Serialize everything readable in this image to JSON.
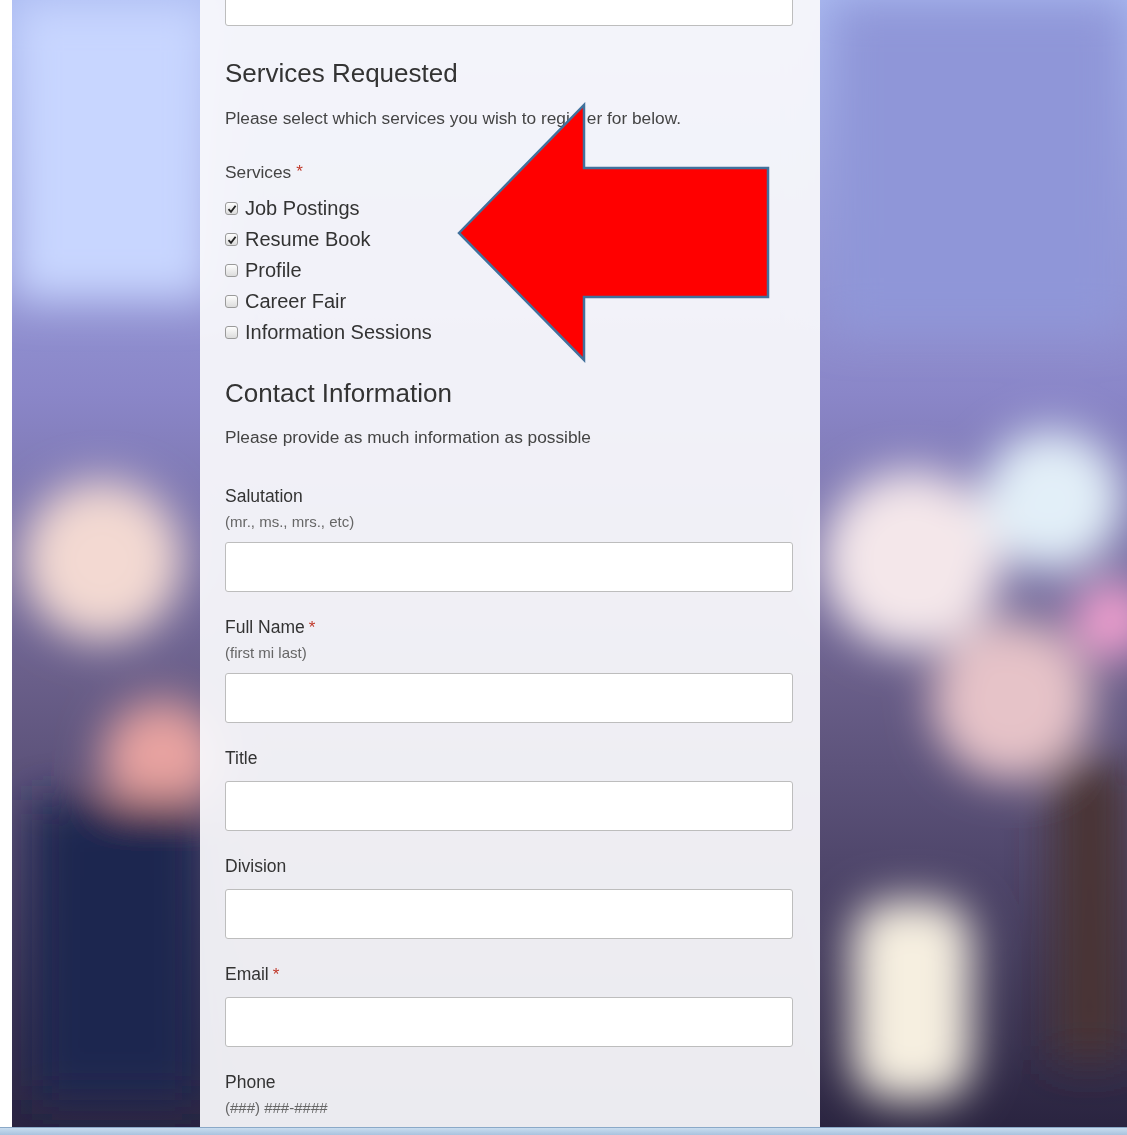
{
  "services": {
    "heading": "Services Requested",
    "description_parts": [
      "Please select which services you wish to regi",
      "er for below."
    ],
    "group_label": "Services",
    "required_mark": "*",
    "options": [
      {
        "label": "Job Postings",
        "checked": true
      },
      {
        "label": "Resume Book",
        "checked": true
      },
      {
        "label": "Profile",
        "checked": false
      },
      {
        "label": "Career Fair",
        "checked": false
      },
      {
        "label": "Information Sessions",
        "checked": false
      }
    ]
  },
  "contact": {
    "heading": "Contact Information",
    "description": "Please provide as much information as possible",
    "fields": [
      {
        "label": "Salutation",
        "hint": "(mr., ms., mrs., etc)"
      },
      {
        "label": "Full Name",
        "required_mark": "*",
        "hint": "(first mi last)"
      },
      {
        "label": "Title"
      },
      {
        "label": "Division"
      },
      {
        "label": "Email",
        "required_mark": "*"
      },
      {
        "label": "Phone",
        "hint": "(###) ###-####"
      }
    ]
  },
  "annotation": {
    "kind": "arrow"
  }
}
